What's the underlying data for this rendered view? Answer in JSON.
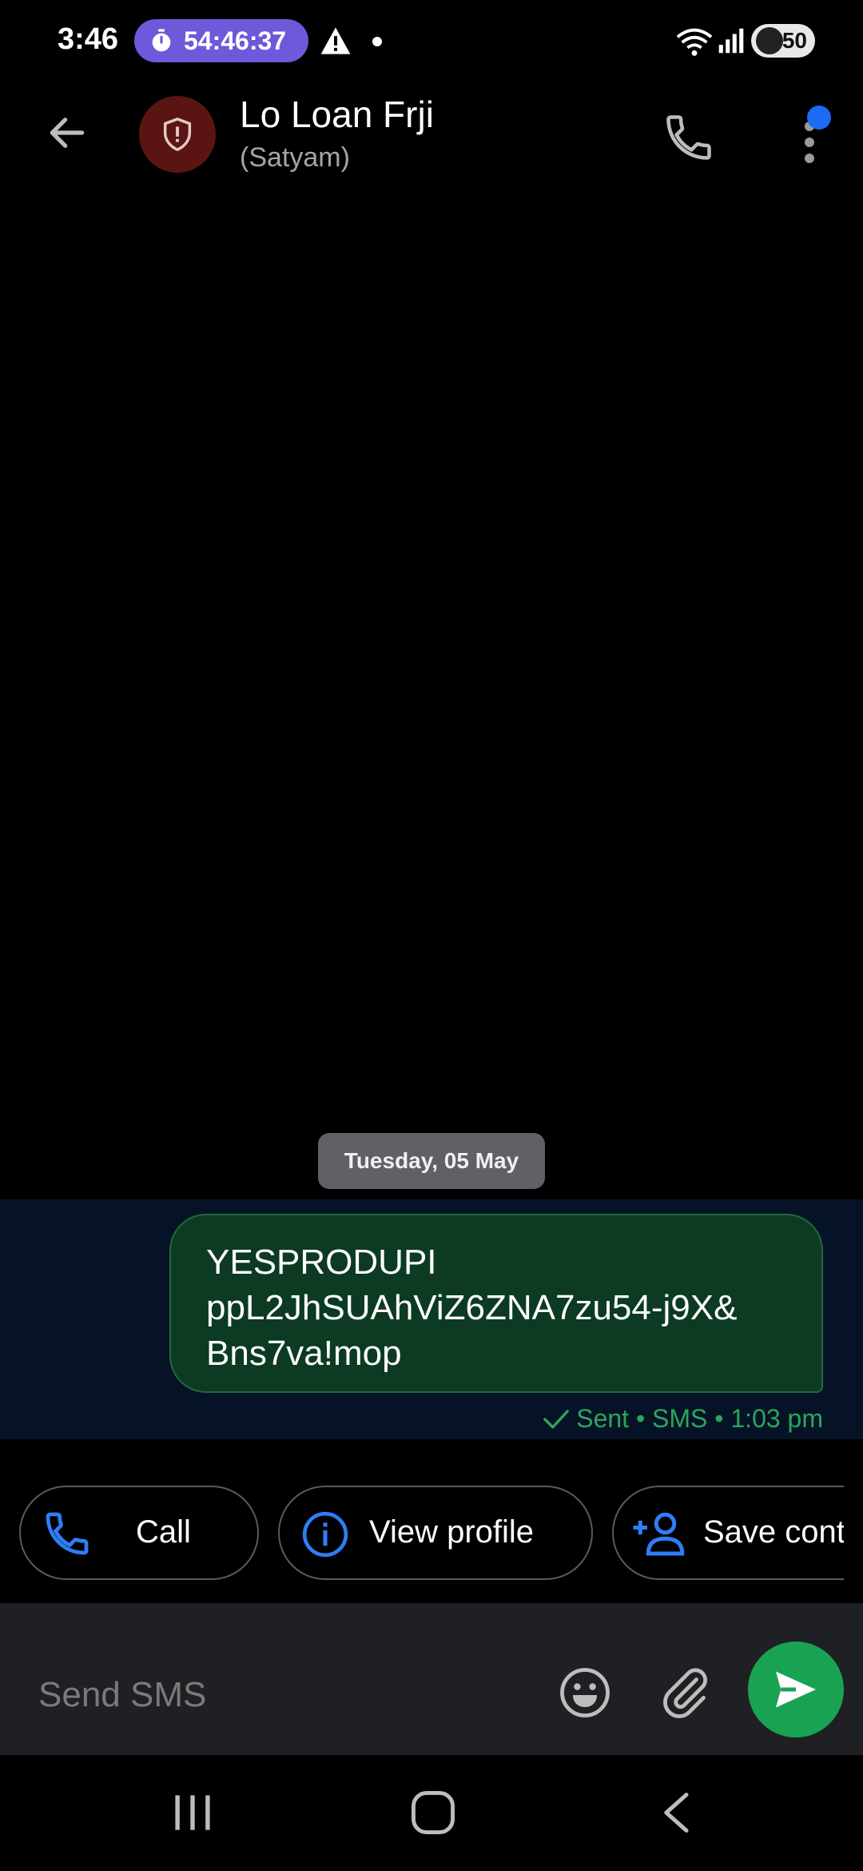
{
  "status_bar": {
    "time": "3:46",
    "timer": "54:46:37",
    "battery": "50"
  },
  "header": {
    "contact_name": "Lo Loan Frji",
    "contact_subtitle": "(Satyam)"
  },
  "conversation": {
    "date_label": "Tuesday, 05 May",
    "messages": [
      {
        "lines": [
          "YESPRODUPI",
          "ppL2JhSUAhViZ6ZNA7zu54-j9X&",
          "Bns7va!mop"
        ],
        "status": "Sent • SMS • 1:03 pm"
      }
    ]
  },
  "chips": [
    {
      "label": "Call",
      "icon": "phone-icon"
    },
    {
      "label": "View profile",
      "icon": "info-icon"
    },
    {
      "label": "Save contact",
      "icon": "add-person-icon"
    }
  ],
  "composer": {
    "placeholder": "Send SMS",
    "value": ""
  },
  "colors": {
    "bubble": "#0c3a23",
    "accent_green": "#1aa253",
    "accent_blue": "#1b6bf5",
    "timer_pill": "#6f58d9",
    "avatar": "#5a1512"
  }
}
